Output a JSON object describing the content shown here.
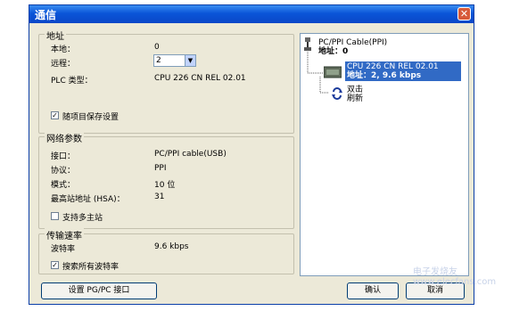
{
  "window": {
    "title": "通信",
    "close_glyph": "✕"
  },
  "address": {
    "legend": "地址",
    "local_label": "本地：",
    "local_value": "0",
    "remote_label": "远程：",
    "remote_value": "2",
    "plc_label": "PLC 类型：",
    "plc_value": "CPU 226 CN REL 02.01",
    "save_label": "随项目保存设置",
    "save_checked": true
  },
  "network": {
    "legend": "网络参数",
    "interface_label": "接口：",
    "interface_value": "PC/PPI cable(USB)",
    "protocol_label": "协议：",
    "protocol_value": "PPI",
    "mode_label": "模式：",
    "mode_value": "10 位",
    "hsa_label": "最高站地址 (HSA)：",
    "hsa_value": "31",
    "multimaster_label": "支持多主站",
    "multimaster_checked": false
  },
  "baud": {
    "legend": "传输速率",
    "rate_label": "波特率",
    "rate_value": "9.6 kbps",
    "search_label": "搜索所有波特率",
    "search_checked": true
  },
  "tree": {
    "cable_name": "PC/PPI Cable(PPI)",
    "cable_addr": "地址：0",
    "cpu_name": "CPU 226 CN REL 02.01",
    "cpu_addr": "地址：2, 9.6 kbps",
    "refresh_line1": "双击",
    "refresh_line2": "刷新"
  },
  "buttons": {
    "setup": "设置 PG/PC 接口",
    "ok": "确认",
    "cancel": "取消"
  },
  "watermark": "电子发烧友  www.elecfans.com"
}
